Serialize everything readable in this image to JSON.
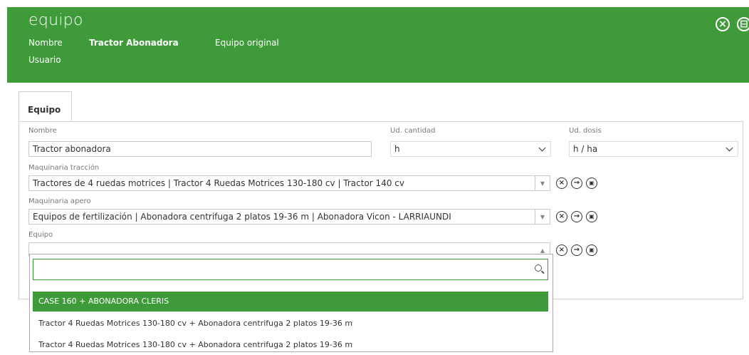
{
  "header": {
    "title": "equipo",
    "nombre_label": "Nombre",
    "nombre_value": "Tractor Abonadora",
    "original_label": "Equipo original",
    "usuario_label": "Usuario",
    "close_icon": "×",
    "save_icon": "⊟"
  },
  "tabs": [
    {
      "label": "Equipo"
    }
  ],
  "form": {
    "nombre": {
      "label": "Nombre",
      "value": "Tractor abonadora"
    },
    "ud_cantidad": {
      "label": "Ud. cantidad",
      "value": "h"
    },
    "ud_dosis": {
      "label": "Ud. dosis",
      "value": "h / ha"
    },
    "maquinaria_traccion": {
      "label": "Maquinaria tracción",
      "value": "Tractores de 4 ruedas motrices | Tractor 4 Ruedas Motrices 130-180 cv | Tractor 140 cv"
    },
    "maquinaria_apero": {
      "label": "Maquinaria apero",
      "value": "Equipos de fertilización | Abonadora centrifuga 2 platos 19-36 m | Abonadora Vicon - LARRIAUNDI"
    },
    "equipo": {
      "label": "Equipo",
      "value": ""
    }
  },
  "icons": {
    "clear": "×",
    "go": "→",
    "details": "▣",
    "arrow_down": "▼",
    "arrow_up": "▲"
  },
  "dropdown": {
    "search_value": "",
    "options": [
      {
        "label": "CASE 160 + ABONADORA CLERIS",
        "selected": true
      },
      {
        "label": "Tractor 4 Ruedas Motrices 130-180 cv + Abonadora centrifuga 2 platos 19-36 m",
        "selected": false
      },
      {
        "label": "Tractor 4 Ruedas Motrices 130-180 cv + Abonadora centrifuga 2 platos 19-36 m",
        "selected": false
      }
    ]
  },
  "colors": {
    "accent": "#3f9b39"
  }
}
